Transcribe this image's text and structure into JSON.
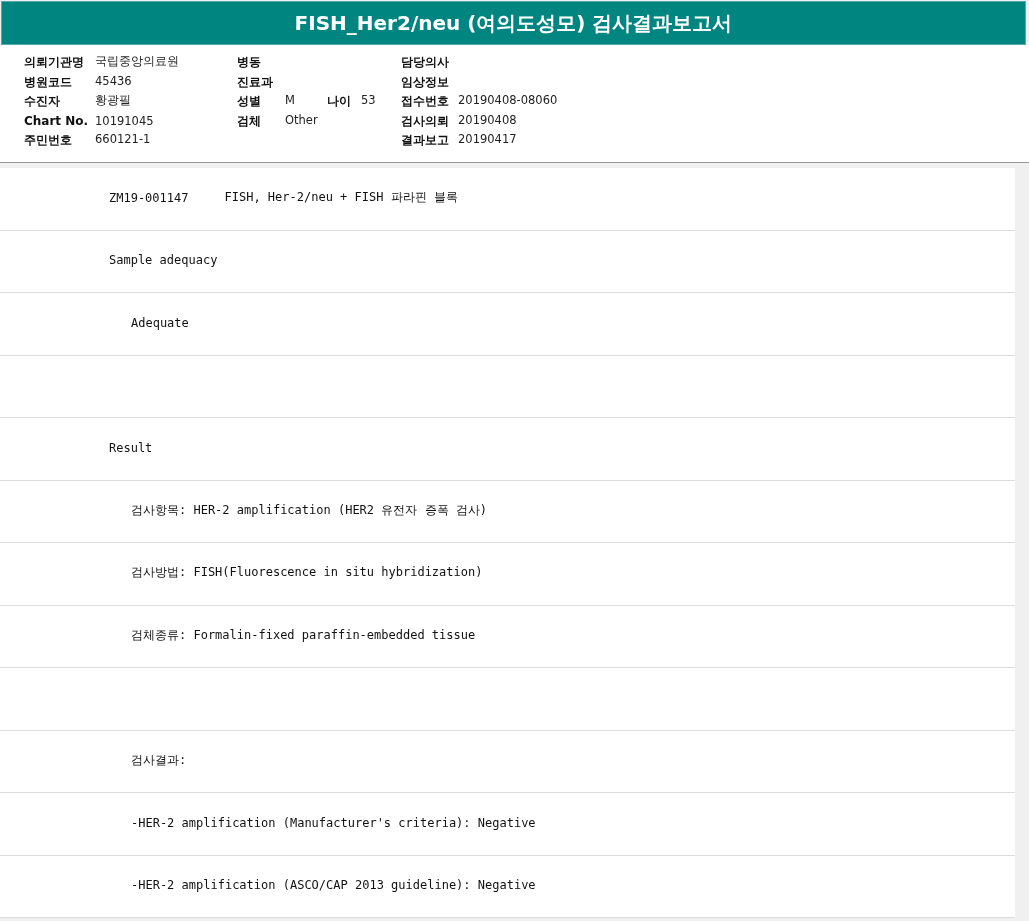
{
  "window": {
    "title": "FISH_Her2/neu (여의도성모) 검사결과보고서"
  },
  "header": {
    "rows": [
      {
        "left": {
          "label": "의뢰기관명",
          "value": "국립중앙의료원"
        },
        "middle": {
          "label": "병동"
        },
        "right": {
          "label": "담당의사"
        }
      },
      {
        "left": {
          "label": "병원코드",
          "value": "45436"
        },
        "middle": {
          "label": "진료과"
        },
        "right": {
          "label": "임상정보"
        }
      },
      {
        "left": {
          "label": "수진자",
          "value": "황광필"
        },
        "middle": {
          "label": "성별",
          "value": "M",
          "extra": {
            "label": "나이",
            "value": "53"
          }
        },
        "right": {
          "label": "접수번호",
          "value": "20190408-08060"
        }
      },
      {
        "left": {
          "label": "Chart No.",
          "value": "10191045"
        },
        "middle": {
          "label": "검체",
          "value": "Other"
        },
        "right": {
          "label": "검사의뢰",
          "value": "20190408"
        }
      },
      {
        "left": {
          "label": "주민번호",
          "value": "660121-1"
        },
        "right": {
          "label": "결과보고",
          "value": "20190417"
        }
      }
    ]
  },
  "report": [
    {
      "kind": "specimen",
      "code": "ZM19-001147",
      "test": "FISH, Her-2/neu + FISH 파라핀 블록"
    },
    {
      "kind": "line",
      "text": "Sample adequacy",
      "children": [
        {
          "kind": "line",
          "text": "Adequate"
        }
      ]
    },
    {
      "kind": "blank"
    },
    {
      "kind": "line",
      "text": "Result",
      "children": [
        {
          "kind": "line",
          "text": "검사항목: HER-2 amplification (HER2 유전자 증폭 검사)"
        },
        {
          "kind": "line",
          "text": "검사방법: FISH(Fluorescence in situ hybridization)"
        },
        {
          "kind": "line",
          "text": "검체종류: Formalin-fixed paraffin-embedded tissue"
        },
        {
          "kind": "blank"
        },
        {
          "kind": "line",
          "text": "검사결과:"
        },
        {
          "kind": "line",
          "text": "-HER-2 amplification (Manufacturer's criteria): Negative"
        },
        {
          "kind": "line",
          "text": "-HER-2 amplification (ASCO/CAP 2013 guideline): Negative"
        }
      ]
    }
  ]
}
